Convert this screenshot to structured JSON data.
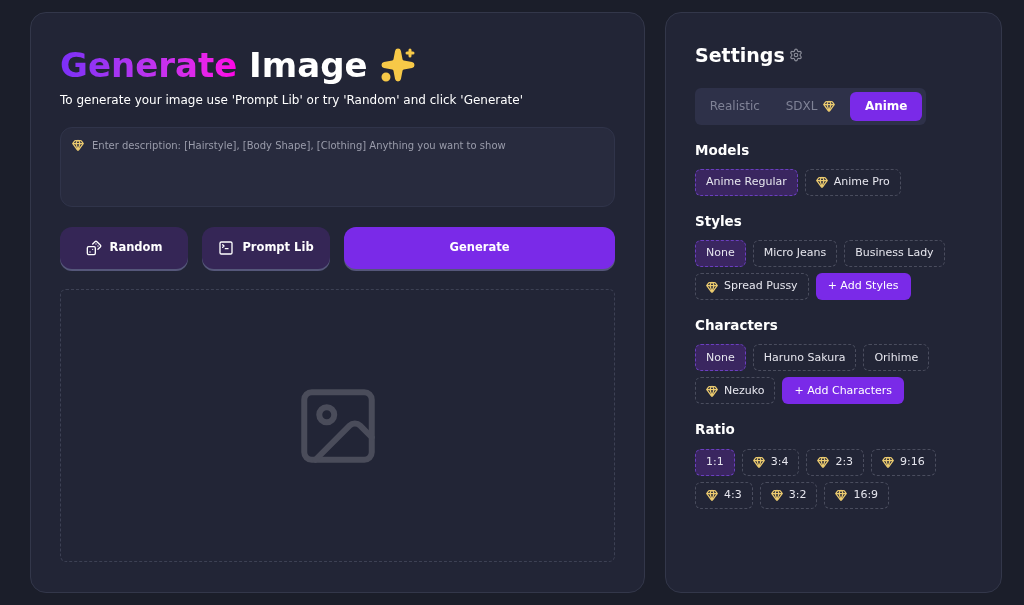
{
  "header": {
    "title_accent": "Generate",
    "title_rest": "Image",
    "subtitle": "To generate your image use 'Prompt Lib' or try 'Random' and click 'Generate'"
  },
  "prompt": {
    "placeholder": "Enter description: [Hairstyle], [Body Shape], [Clothing] Anything you want to show",
    "premium": true
  },
  "actions": [
    {
      "kind": "random",
      "label": "Random"
    },
    {
      "kind": "library",
      "label": "Prompt Lib"
    },
    {
      "kind": "primary",
      "label": "Generate"
    }
  ],
  "preview": {
    "kind": "placeholder"
  },
  "settings": {
    "title": "Settings",
    "tabs": [
      {
        "label": "Realistic",
        "selected": false,
        "premium": false
      },
      {
        "label": "SDXL",
        "selected": false,
        "premium": true
      },
      {
        "label": "Anime",
        "selected": true,
        "premium": false
      }
    ],
    "sections": [
      {
        "title": "Models",
        "options": [
          {
            "kind": "option",
            "label": "Anime Regular",
            "selected": true,
            "premium": false
          },
          {
            "kind": "option",
            "label": "Anime Pro",
            "selected": false,
            "premium": true
          }
        ]
      },
      {
        "title": "Styles",
        "options": [
          {
            "kind": "option",
            "label": "None",
            "selected": true,
            "premium": false
          },
          {
            "kind": "option",
            "label": "Micro Jeans",
            "selected": false,
            "premium": false
          },
          {
            "kind": "option",
            "label": "Business Lady",
            "selected": false,
            "premium": false
          },
          {
            "kind": "option",
            "label": "Spread Pussy",
            "selected": false,
            "premium": true
          },
          {
            "kind": "add",
            "label": "+ Add Styles"
          }
        ]
      },
      {
        "title": "Characters",
        "options": [
          {
            "kind": "option",
            "label": "None",
            "selected": true,
            "premium": false
          },
          {
            "kind": "option",
            "label": "Haruno Sakura",
            "selected": false,
            "premium": false
          },
          {
            "kind": "option",
            "label": "Orihime",
            "selected": false,
            "premium": false
          },
          {
            "kind": "option",
            "label": "Nezuko",
            "selected": false,
            "premium": true
          },
          {
            "kind": "add",
            "label": "+ Add Characters"
          }
        ]
      },
      {
        "title": "Ratio",
        "options": [
          {
            "kind": "option",
            "label": "1:1",
            "selected": true,
            "premium": false
          },
          {
            "kind": "option",
            "label": "3:4",
            "selected": false,
            "premium": true
          },
          {
            "kind": "option",
            "label": "2:3",
            "selected": false,
            "premium": true
          },
          {
            "kind": "option",
            "label": "9:16",
            "selected": false,
            "premium": true
          },
          {
            "kind": "option",
            "label": "4:3",
            "selected": false,
            "premium": true
          },
          {
            "kind": "option",
            "label": "3:2",
            "selected": false,
            "premium": true
          },
          {
            "kind": "option",
            "label": "16:9",
            "selected": false,
            "premium": true
          }
        ]
      }
    ]
  }
}
